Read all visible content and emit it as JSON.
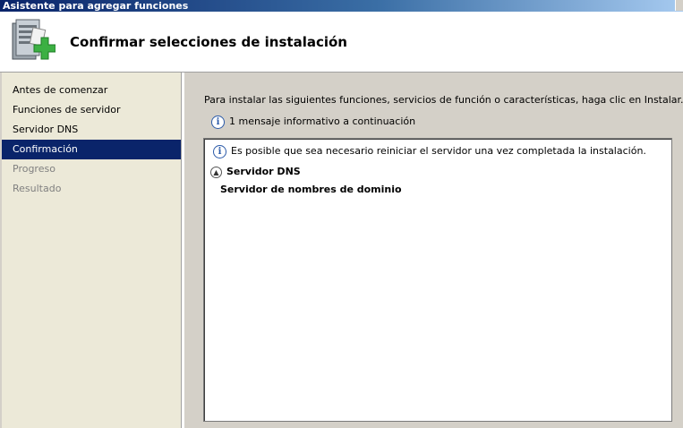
{
  "window": {
    "title": "Asistente para agregar funciones"
  },
  "header": {
    "title": "Confirmar selecciones de instalación",
    "icon": "server-add-icon"
  },
  "nav": {
    "items": [
      {
        "label": "Antes de comenzar",
        "state": "normal"
      },
      {
        "label": "Funciones de servidor",
        "state": "normal"
      },
      {
        "label": "Servidor DNS",
        "state": "normal"
      },
      {
        "label": "Confirmación",
        "state": "selected"
      },
      {
        "label": "Progreso",
        "state": "disabled"
      },
      {
        "label": "Resultado",
        "state": "disabled"
      }
    ]
  },
  "main": {
    "instruction": "Para instalar las siguientes funciones, servicios de función o características, haga clic en Instalar.",
    "info_message": "1 mensaje informativo a continuación",
    "results": {
      "warning": "Es posible que sea necesario reiniciar el servidor una vez completada la instalación.",
      "section_title": "Servidor DNS",
      "section_items": [
        "Servidor de nombres de dominio"
      ]
    }
  },
  "colors": {
    "selection": "#0a246a",
    "info_icon": "#2b5aa8",
    "plus_icon": "#3cb043"
  }
}
